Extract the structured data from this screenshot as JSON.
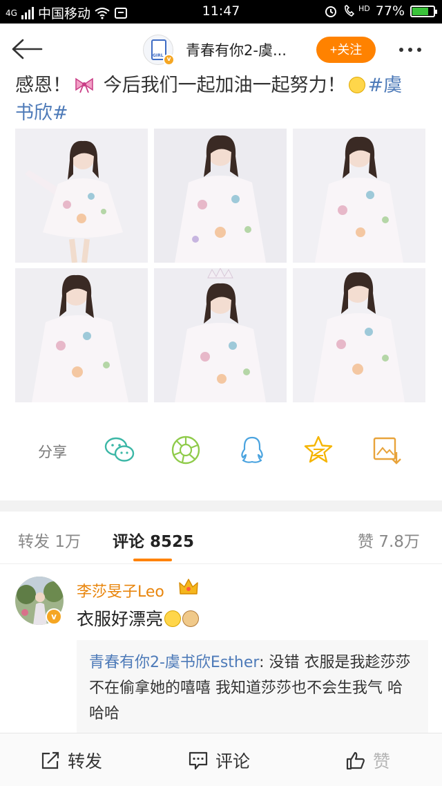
{
  "status_bar": {
    "network_label": "4G",
    "carrier": "中国移动",
    "time": "11:47",
    "hd_label": "HD",
    "battery_percent": "77%",
    "battery_level": 0.77
  },
  "header": {
    "account_name": "青春有你2-虞...",
    "avatar_text": "GIRL",
    "verified_badge": "v",
    "follow_label": "+关注"
  },
  "post": {
    "text_part1": "感恩！",
    "text_part2": " 今后我们一起加油一起努力！",
    "hashtag": "#虞书欣#"
  },
  "photos": [
    {
      "bg": "#f0eff3",
      "pose": "arm-raised"
    },
    {
      "bg": "#ecebf0",
      "pose": "hands-together"
    },
    {
      "bg": "#f1f0f4",
      "pose": "standing"
    },
    {
      "bg": "#efeef2",
      "pose": "side"
    },
    {
      "bg": "#eeedf2",
      "pose": "crown"
    },
    {
      "bg": "#f1f0f4",
      "pose": "looking-down"
    }
  ],
  "share": {
    "label": "分享",
    "icons": [
      "wechat-icon",
      "moments-icon",
      "qq-icon",
      "qzone-icon",
      "save-image-icon"
    ]
  },
  "tabs": {
    "repost_label": "转发",
    "repost_count": "1万",
    "comment_label": "评论",
    "comment_count": "8525",
    "like_label": "赞",
    "like_count": "7.8万"
  },
  "comment": {
    "user": "李莎旻子Leo",
    "text": "衣服好漂亮",
    "verified_badge": "v"
  },
  "reply": {
    "user": "青春有你2-虞书欣Esther",
    "text": ": 没错 衣服是我趁莎莎不在偷拿她的嘻嘻 我知道莎莎也不会生我气 哈哈哈"
  },
  "bottom_bar": {
    "repost_label": "转发",
    "comment_label": "评论",
    "like_label": "赞"
  },
  "colors": {
    "accent": "#ff8200",
    "link": "#4d7ab8",
    "username": "#e8850c"
  }
}
